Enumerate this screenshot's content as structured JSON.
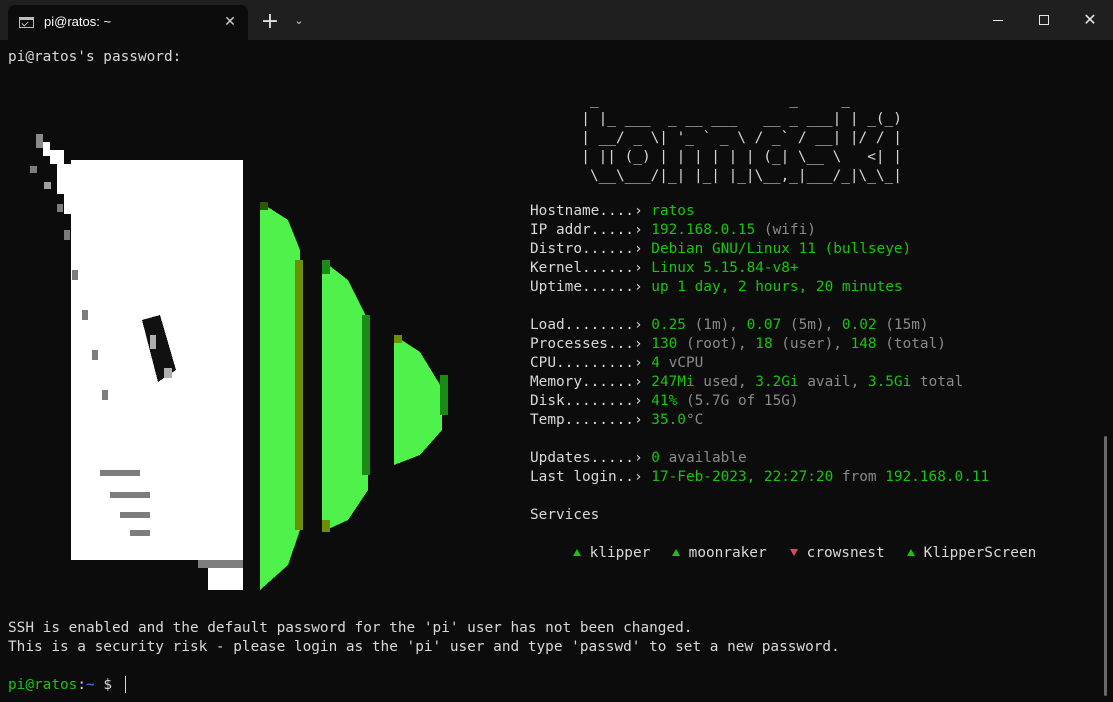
{
  "window": {
    "tab_title": "pi@ratos: ~",
    "tab_close": "✕",
    "new_tab": "+",
    "dropdown": "⌄",
    "close": "✕"
  },
  "terminal": {
    "password_prompt": "pi@ratos's password:",
    "ascii_art": "         _                      _     _\n        | |_ ___  _ __ ___   __ _ ___| | _(_)\n        | __/ _ \\| '_ ` _ \\ / _` / __| |/ / |\n        | || (_) | | | | | | (_| \\__ \\   <| |\n         \\__\\___/|_| |_| |_|\\__,_|___/_|\\_\\_|",
    "info": [
      {
        "label": "Hostname....› ",
        "parts": [
          {
            "t": "ratos",
            "c": "g"
          }
        ]
      },
      {
        "label": "IP addr.....› ",
        "parts": [
          {
            "t": "192.168.0.15",
            "c": "g"
          },
          {
            "t": " (wifi)",
            "c": "dim"
          }
        ]
      },
      {
        "label": "Distro......› ",
        "parts": [
          {
            "t": "Debian GNU/Linux 11 (bullseye)",
            "c": "g"
          }
        ]
      },
      {
        "label": "Kernel......› ",
        "parts": [
          {
            "t": "Linux 5.15.84-v8+",
            "c": "g"
          }
        ]
      },
      {
        "label": "Uptime......› ",
        "parts": [
          {
            "t": "up 1 day, 2 hours, 20 minutes",
            "c": "g"
          }
        ]
      }
    ],
    "stats": [
      {
        "label": "Load........› ",
        "parts": [
          {
            "t": "0.25",
            "c": "g"
          },
          {
            "t": " (1m), ",
            "c": "dim"
          },
          {
            "t": "0.07",
            "c": "g"
          },
          {
            "t": " (5m), ",
            "c": "dim"
          },
          {
            "t": "0.02",
            "c": "g"
          },
          {
            "t": " (15m)",
            "c": "dim"
          }
        ]
      },
      {
        "label": "Processes...› ",
        "parts": [
          {
            "t": "130",
            "c": "g"
          },
          {
            "t": " (root), ",
            "c": "dim"
          },
          {
            "t": "18",
            "c": "g"
          },
          {
            "t": " (user), ",
            "c": "dim"
          },
          {
            "t": "148",
            "c": "g"
          },
          {
            "t": " (total)",
            "c": "dim"
          }
        ]
      },
      {
        "label": "CPU.........› ",
        "parts": [
          {
            "t": "4",
            "c": "g"
          },
          {
            "t": " vCPU",
            "c": "dim"
          }
        ]
      },
      {
        "label": "Memory......› ",
        "parts": [
          {
            "t": "247Mi",
            "c": "g"
          },
          {
            "t": " used, ",
            "c": "dim"
          },
          {
            "t": "3.2Gi",
            "c": "g"
          },
          {
            "t": " avail, ",
            "c": "dim"
          },
          {
            "t": "3.5Gi",
            "c": "g"
          },
          {
            "t": " total",
            "c": "dim"
          }
        ]
      },
      {
        "label": "Disk........› ",
        "parts": [
          {
            "t": "41%",
            "c": "g"
          },
          {
            "t": " (5.7G of 15G)",
            "c": "dim"
          }
        ]
      },
      {
        "label": "Temp........› ",
        "parts": [
          {
            "t": "35.0",
            "c": "g"
          },
          {
            "t": "°C",
            "c": "dim"
          }
        ]
      }
    ],
    "updates": [
      {
        "label": "Updates.....› ",
        "parts": [
          {
            "t": "0",
            "c": "g"
          },
          {
            "t": " available",
            "c": "dim"
          }
        ]
      },
      {
        "label": "Last login..› ",
        "parts": [
          {
            "t": "17-Feb-2023, 22:27:20",
            "c": "g"
          },
          {
            "t": " from ",
            "c": "dim"
          },
          {
            "t": "192.168.0.11",
            "c": "g"
          }
        ]
      }
    ],
    "services_heading": "Services",
    "services": [
      {
        "name": "klipper",
        "status": "up"
      },
      {
        "name": "moonraker",
        "status": "up"
      },
      {
        "name": "crowsnest",
        "status": "down"
      },
      {
        "name": "KlipperScreen",
        "status": "up"
      }
    ],
    "warning_1": "SSH is enabled and the default password for the 'pi' user has not been changed.",
    "warning_2": "This is a security risk - please login as the 'pi' user and type 'passwd' to set a new password.",
    "prompt_user": "pi@ratos",
    "prompt_colon": ":",
    "prompt_path": "~",
    "prompt_symbol": " $",
    "colors": {
      "green": "#16c60c",
      "bright_green": "#4ff24a",
      "red": "#e74856",
      "blue": "#3b78ff",
      "background": "#0c0c0c"
    }
  }
}
